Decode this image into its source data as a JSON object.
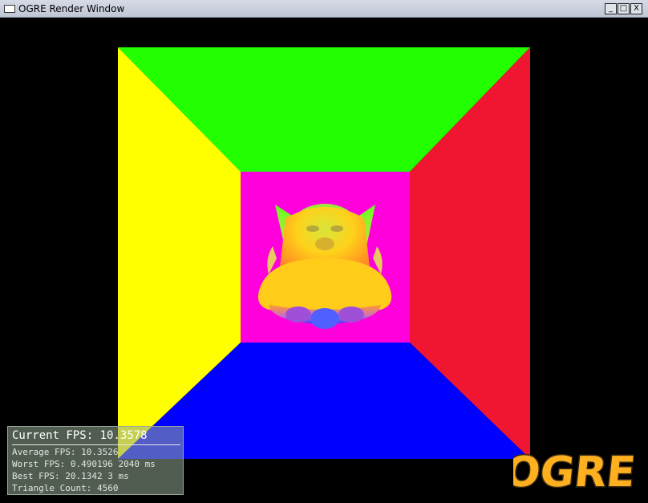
{
  "window": {
    "title": "OGRE Render Window",
    "buttons": {
      "minimize": "_",
      "maximize": "□",
      "close": "X"
    }
  },
  "scene": {
    "colors": {
      "top_wall": "#22ff00",
      "left_wall": "#ffff00",
      "right_wall": "#f01632",
      "floor": "#0000ff",
      "back_wall": "#ff00dd",
      "background": "#000000"
    },
    "model": "ogre-head"
  },
  "stats": {
    "current_fps": "Current FPS: 10.3578",
    "average_fps": "Average FPS: 10.3526",
    "worst_fps": "Worst FPS: 0.490196 2040 ms",
    "best_fps": "Best FPS: 20.1342 3 ms",
    "triangle_count": "Triangle Count: 4560"
  },
  "logo": {
    "text": "OGRE"
  }
}
